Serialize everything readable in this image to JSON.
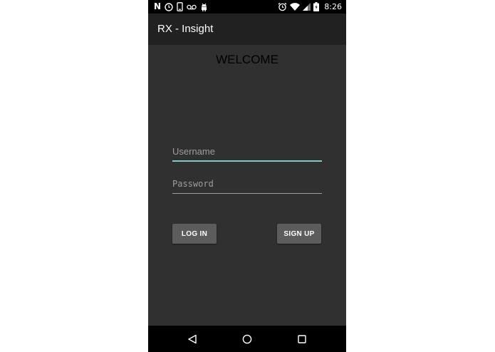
{
  "status_bar": {
    "time": "8:26",
    "left_icons": [
      "netflix-icon",
      "clock-icon",
      "phone-icon",
      "voicemail-icon",
      "android-icon"
    ],
    "right_icons": [
      "alarm-icon",
      "wifi-icon",
      "signal-icon",
      "battery-icon"
    ],
    "netflix_letter": "N"
  },
  "app_bar": {
    "title": "RX - Insight"
  },
  "main": {
    "welcome_text": "WELCOME",
    "username": {
      "placeholder": "Username",
      "value": ""
    },
    "password": {
      "placeholder": "Password",
      "value": ""
    },
    "login_label": "LOG IN",
    "signup_label": "SIGN UP"
  },
  "nav_bar": {
    "icons": [
      "back-icon",
      "home-icon",
      "recents-icon"
    ]
  },
  "colors": {
    "background": "#303030",
    "app_bar": "#212121",
    "accent": "#80cbc4",
    "button": "#5c5c5c"
  }
}
